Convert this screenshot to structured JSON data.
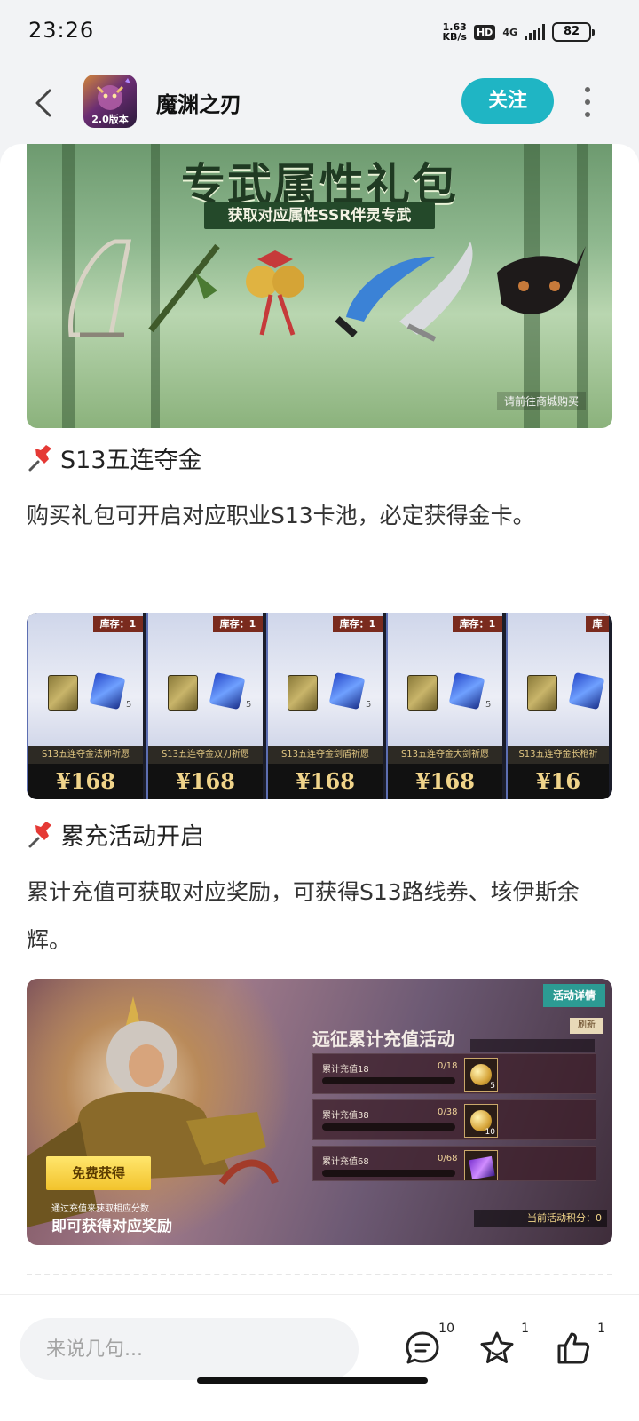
{
  "status_bar": {
    "time": "23:26",
    "net_speed_value": "1.63",
    "net_speed_unit": "KB/s",
    "hd_badge": "HD",
    "network_type": "4G",
    "battery": "82"
  },
  "header": {
    "app_title": "魔渊之刃",
    "avatar_badge": "2.0版本",
    "follow_label": "关注"
  },
  "banner1": {
    "title": "专武属性礼包",
    "subtitle": "获取对应属性SSR伴灵专武",
    "note": "请前往商城购买"
  },
  "section1": {
    "title": "S13五连夺金",
    "text": "购买礼包可开启对应职业S13卡池，必定获得金卡。"
  },
  "banner2": {
    "packs": [
      {
        "stock": "库存：1",
        "qty": "5",
        "name": "S13五连夺金法师祈愿",
        "price": "¥168"
      },
      {
        "stock": "库存：1",
        "qty": "5",
        "name": "S13五连夺金双刀祈愿",
        "price": "¥168"
      },
      {
        "stock": "库存：1",
        "qty": "5",
        "name": "S13五连夺金剑盾祈愿",
        "price": "¥168"
      },
      {
        "stock": "库存：1",
        "qty": "5",
        "name": "S13五连夺金大剑祈愿",
        "price": "¥168"
      },
      {
        "stock": "库",
        "qty": "",
        "name": "S13五连夺金长枪祈",
        "price": "¥16"
      }
    ]
  },
  "section2": {
    "title": "累充活动开启",
    "text": "累计充值可获取对应奖励，可获得S13路线券、垓伊斯余辉。"
  },
  "banner3": {
    "details_label": "活动详情",
    "refresh_label": "刷新",
    "panel_title": "远征累计充值活动",
    "rows": [
      {
        "label": "累计充值18",
        "progress": "0/18",
        "reward_qty": "5"
      },
      {
        "label": "累计充值38",
        "progress": "0/38",
        "reward_qty": "10"
      },
      {
        "label": "累计充值68",
        "progress": "0/68",
        "reward_qty": ""
      }
    ],
    "free_button": "免费获得",
    "promo_small": "通过充值来获取相应分数",
    "promo_big": "即可获得对应奖励",
    "points": "当前活动积分：0"
  },
  "bottom_bar": {
    "comment_placeholder": "来说几句...",
    "comment_count": "10",
    "favorite_count": "1",
    "like_count": "1"
  }
}
